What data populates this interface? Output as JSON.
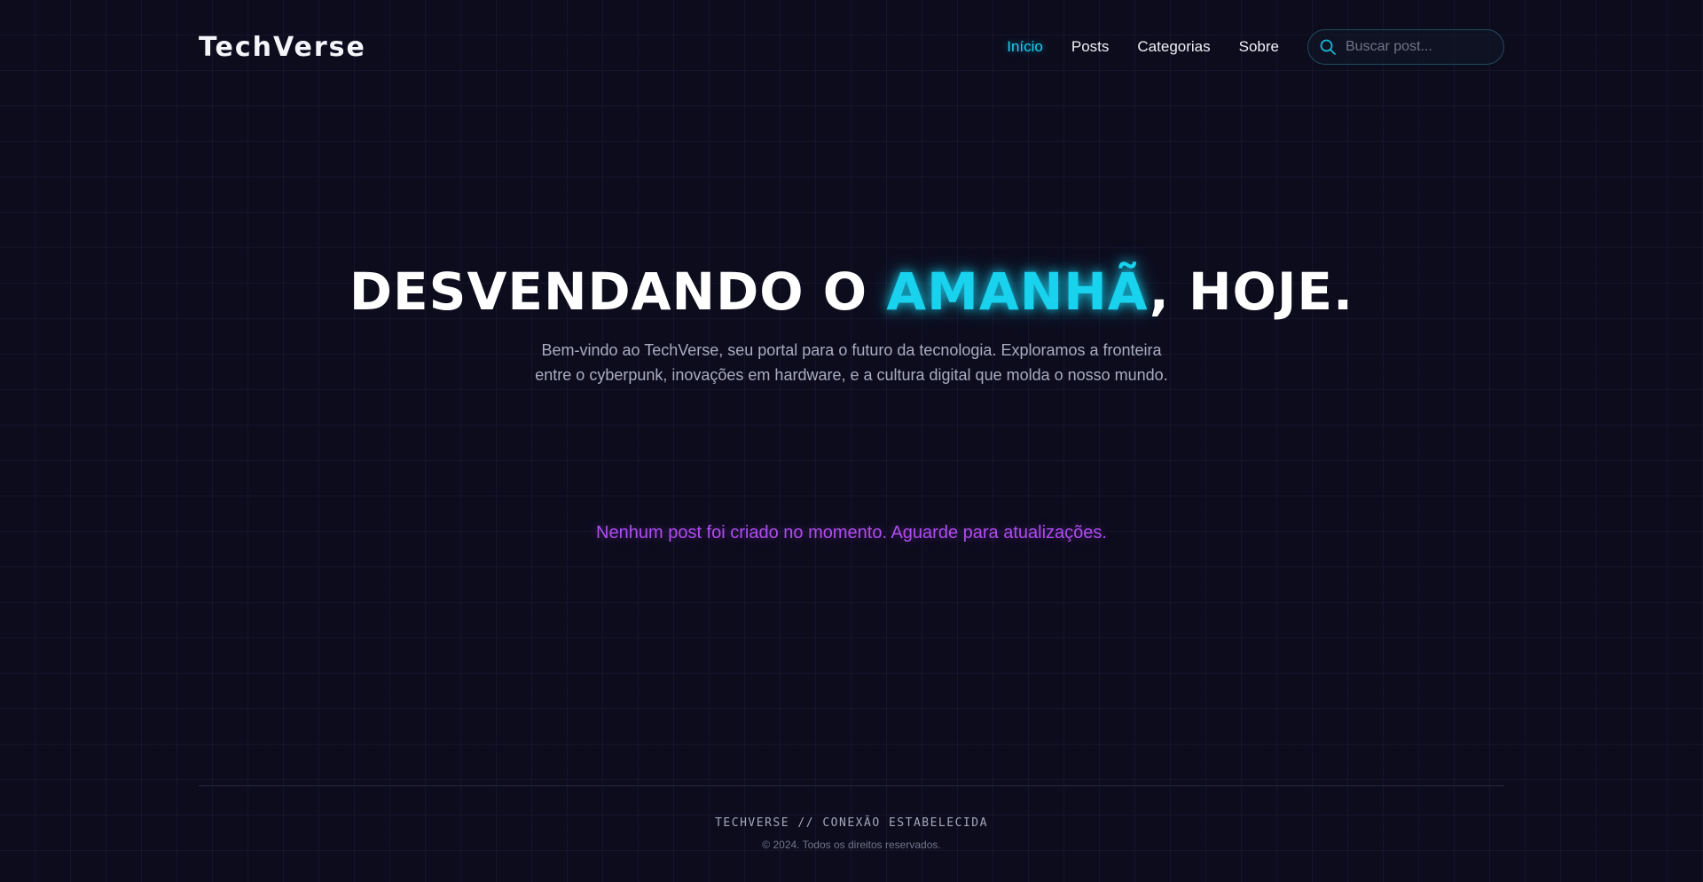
{
  "header": {
    "logo": "TechVerse",
    "nav": [
      {
        "label": "Início",
        "active": true
      },
      {
        "label": "Posts",
        "active": false
      },
      {
        "label": "Categorias",
        "active": false
      },
      {
        "label": "Sobre",
        "active": false
      }
    ],
    "search": {
      "placeholder": "Buscar post...",
      "value": "",
      "icon": "search-icon"
    }
  },
  "hero": {
    "title_before": "DESVENDANDO O ",
    "title_accent": "AMANHÃ",
    "title_after": ", HOJE.",
    "description_line1": "Bem-vindo ao TechVerse, seu portal para o futuro da tecnologia. Exploramos a fronteira",
    "description_line2": "entre o cyberpunk, inovações em hardware, e a cultura digital que molda o nosso mundo."
  },
  "posts": {
    "empty_message": "Nenhum post foi criado no momento. Aguarde para atualizações."
  },
  "footer": {
    "brand": "TECHVERSE // CONEXÃO ESTABELECIDA",
    "copyright": "© 2024. Todos os direitos reservados."
  },
  "colors": {
    "background": "#0d0c1d",
    "accent_cyan": "#19d2ee",
    "accent_purple": "#b04cf0",
    "text": "#e6e8f0"
  }
}
